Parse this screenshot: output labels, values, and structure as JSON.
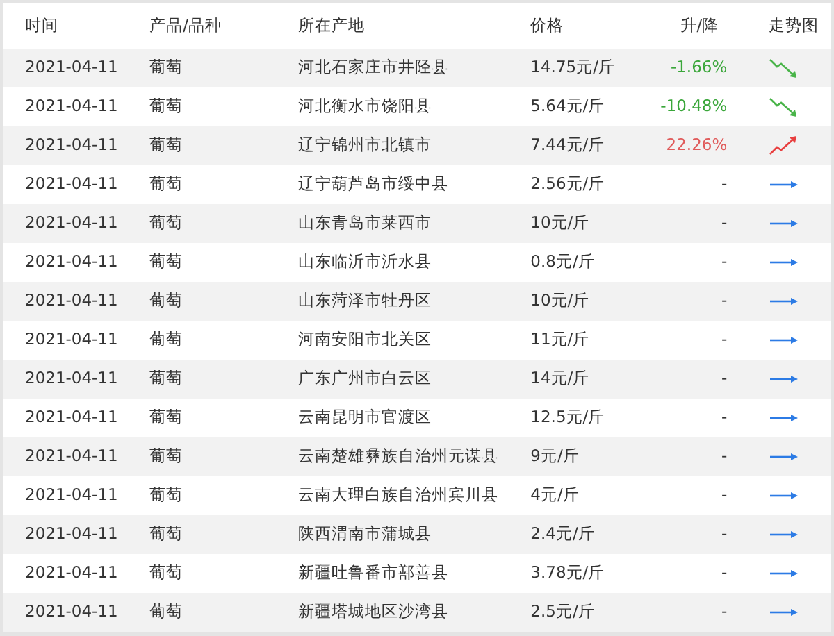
{
  "columns": [
    "时间",
    "产品/品种",
    "所在产地",
    "价格",
    "升/降",
    "走势图"
  ],
  "rows": [
    {
      "date": "2021-04-11",
      "product": "葡萄",
      "origin": "河北石家庄市井陉县",
      "price": "14.75元/斤",
      "change": "-1.66%",
      "kind": "down"
    },
    {
      "date": "2021-04-11",
      "product": "葡萄",
      "origin": "河北衡水市饶阳县",
      "price": "5.64元/斤",
      "change": "-10.48%",
      "kind": "down"
    },
    {
      "date": "2021-04-11",
      "product": "葡萄",
      "origin": "辽宁锦州市北镇市",
      "price": "7.44元/斤",
      "change": "22.26%",
      "kind": "up"
    },
    {
      "date": "2021-04-11",
      "product": "葡萄",
      "origin": "辽宁葫芦岛市绥中县",
      "price": "2.56元/斤",
      "change": "-",
      "kind": "flat"
    },
    {
      "date": "2021-04-11",
      "product": "葡萄",
      "origin": "山东青岛市莱西市",
      "price": "10元/斤",
      "change": "-",
      "kind": "flat"
    },
    {
      "date": "2021-04-11",
      "product": "葡萄",
      "origin": "山东临沂市沂水县",
      "price": "0.8元/斤",
      "change": "-",
      "kind": "flat"
    },
    {
      "date": "2021-04-11",
      "product": "葡萄",
      "origin": "山东菏泽市牡丹区",
      "price": "10元/斤",
      "change": "-",
      "kind": "flat"
    },
    {
      "date": "2021-04-11",
      "product": "葡萄",
      "origin": "河南安阳市北关区",
      "price": "11元/斤",
      "change": "-",
      "kind": "flat"
    },
    {
      "date": "2021-04-11",
      "product": "葡萄",
      "origin": "广东广州市白云区",
      "price": "14元/斤",
      "change": "-",
      "kind": "flat"
    },
    {
      "date": "2021-04-11",
      "product": "葡萄",
      "origin": "云南昆明市官渡区",
      "price": "12.5元/斤",
      "change": "-",
      "kind": "flat"
    },
    {
      "date": "2021-04-11",
      "product": "葡萄",
      "origin": "云南楚雄彝族自治州元谋县",
      "price": "9元/斤",
      "change": "-",
      "kind": "flat"
    },
    {
      "date": "2021-04-11",
      "product": "葡萄",
      "origin": "云南大理白族自治州宾川县",
      "price": "4元/斤",
      "change": "-",
      "kind": "flat"
    },
    {
      "date": "2021-04-11",
      "product": "葡萄",
      "origin": "陕西渭南市蒲城县",
      "price": "2.4元/斤",
      "change": "-",
      "kind": "flat"
    },
    {
      "date": "2021-04-11",
      "product": "葡萄",
      "origin": "新疆吐鲁番市鄯善县",
      "price": "3.78元/斤",
      "change": "-",
      "kind": "flat"
    },
    {
      "date": "2021-04-11",
      "product": "葡萄",
      "origin": "新疆塔城地区沙湾县",
      "price": "2.5元/斤",
      "change": "-",
      "kind": "flat"
    }
  ]
}
